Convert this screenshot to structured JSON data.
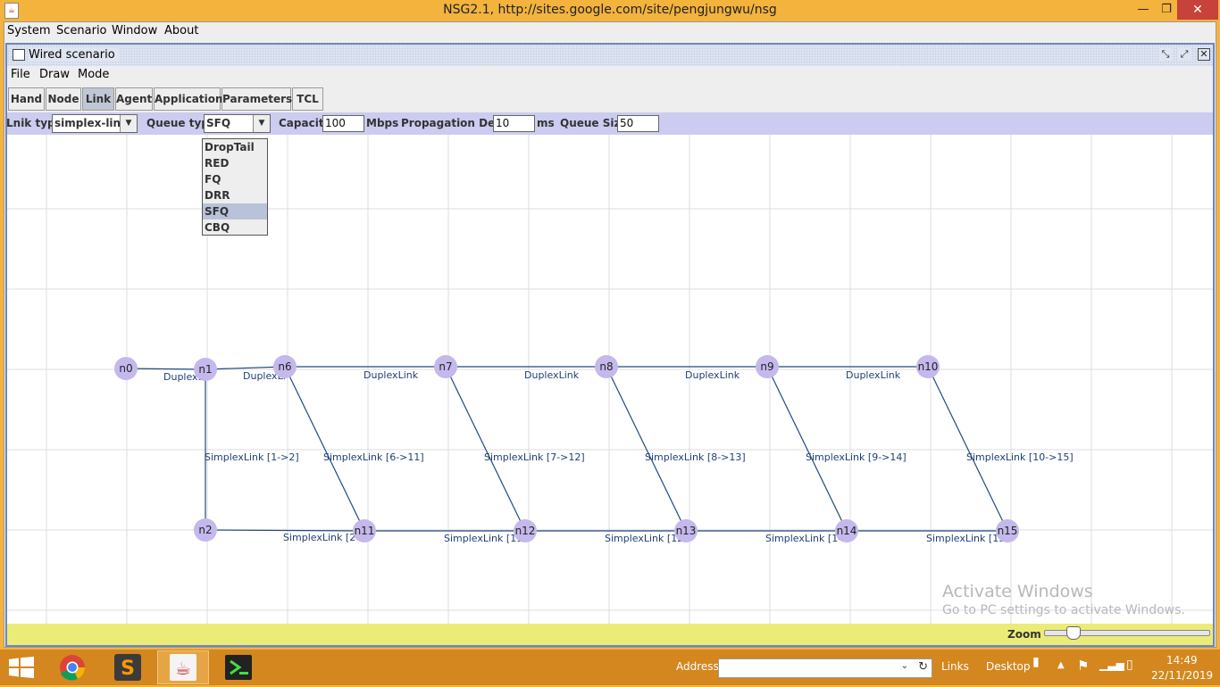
{
  "window": {
    "title": "NSG2.1, http://sites.google.com/site/pengjungwu/nsg",
    "min_glyph": "—",
    "max_glyph": "❐",
    "close_glyph": "✕"
  },
  "main_menu": {
    "items": [
      "System",
      "Scenario",
      "Window",
      "About"
    ]
  },
  "scenario_window": {
    "title": "Wired scenario",
    "menu": [
      "File",
      "Draw",
      "Mode"
    ],
    "toolbar": [
      "Hand",
      "Node",
      "Link",
      "Agent",
      "Application",
      "Parameters",
      "TCL"
    ],
    "active_tool": "Link"
  },
  "link_props": {
    "link_type_label": "Lnik type",
    "link_type_value": "simplex-link",
    "queue_type_label": "Queue type",
    "queue_type_value": "SFQ",
    "capacity_label": "Capacity",
    "capacity_value": "100",
    "capacity_unit": "Mbps",
    "delay_label": "Propagation Delay",
    "delay_value": "10",
    "delay_unit": "ms",
    "queue_size_label": "Queue Size",
    "queue_size_value": "50"
  },
  "queue_options": [
    "DropTail",
    "RED",
    "FQ",
    "DRR",
    "SFQ",
    "CBQ"
  ],
  "selected_queue": "SFQ",
  "topology": {
    "nodes": [
      "n0",
      "n1",
      "n2",
      "n6",
      "n7",
      "n8",
      "n9",
      "n10",
      "n11",
      "n12",
      "n13",
      "n14",
      "n15"
    ],
    "link_labels": {
      "l_n0_n1": "DuplexLi",
      "l_n1_n6": "DuplexLi",
      "l_n6_n7": "DuplexLink",
      "l_n7_n8": "DuplexLink",
      "l_n8_n9": "DuplexLink",
      "l_n9_n10": "DuplexLink",
      "l_n1_n2": "SimplexLink [1->2]",
      "l_n6_n11": "SimplexLink [6->11]",
      "l_n7_n12": "SimplexLink [7->12]",
      "l_n8_n13": "SimplexLink [8->13]",
      "l_n9_n14": "SimplexLink [9->14]",
      "l_n10_n15": "SimplexLink [10->15]",
      "l_n2_n11": "SimplexLink [2->",
      "l_n11_n12": "SimplexLink [11-",
      "l_n12_n13": "SimplexLink [12-",
      "l_n13_n14": "SimplexLink [14-",
      "l_n14_n15": "SimplexLink [15-"
    }
  },
  "status": {
    "zoom_label": "Zoom",
    "zoom_level": 0.15
  },
  "watermark": {
    "line1": "Activate Windows",
    "line2": "Go to PC settings to activate Windows."
  },
  "taskbar": {
    "address_label": "Address",
    "links_label": "Links",
    "desktop_label": "Desktop",
    "time": "14:49",
    "date": "22/11/2019"
  },
  "colors": {
    "node": "#c4b8ec",
    "link": "#1f4a80",
    "propbar": "#ccccf0",
    "statusbar": "#ebeb78",
    "taskbar": "#d4871f"
  }
}
